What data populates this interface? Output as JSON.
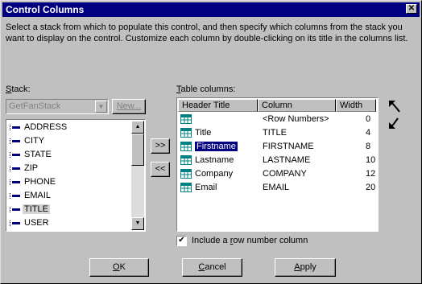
{
  "window": {
    "title": "Control Columns",
    "close_glyph": "✕"
  },
  "description": "Select a stack from which to populate this control, and then specify which columns from the stack you want to display on the control.  Customize each column by double-clicking on its title in the columns list.",
  "stack": {
    "label_prefix": "",
    "label_mnemonic": "S",
    "label_rest": "tack:",
    "selected_value": "GetFanStack",
    "new_button": "New...",
    "items": [
      "ADDRESS",
      "CITY",
      "STATE",
      "ZIP",
      "PHONE",
      "EMAIL",
      "TITLE",
      "USER"
    ],
    "selected_item": "TITLE"
  },
  "move_buttons": {
    "add": ">>",
    "remove": "<<"
  },
  "table_columns": {
    "label_mnemonic": "T",
    "label_rest": "able columns:",
    "headers": [
      "Header Title",
      "Column",
      "Width"
    ],
    "rows": [
      {
        "title": "",
        "column": "<Row Numbers>",
        "width": "0"
      },
      {
        "title": "Title",
        "column": "TITLE",
        "width": "4"
      },
      {
        "title": "Firstname",
        "column": "FIRSTNAME",
        "width": "8"
      },
      {
        "title": "Lastname",
        "column": "LASTNAME",
        "width": "10"
      },
      {
        "title": "Company",
        "column": "COMPANY",
        "width": "12"
      },
      {
        "title": "Email",
        "column": "EMAIL",
        "width": "20"
      }
    ],
    "selected_row": "Firstname"
  },
  "move_up_icon": "move-up-icon",
  "move_down_icon": "move-down-icon",
  "row_number_checkbox": {
    "checked": true,
    "label_prefix": "Include a ",
    "label_mnemonic": "r",
    "label_rest": "ow number column"
  },
  "buttons": {
    "ok": {
      "mnemonic": "O",
      "rest": "K"
    },
    "cancel": {
      "mnemonic": "C",
      "rest": "ancel"
    },
    "apply": {
      "mnemonic": "A",
      "rest": "pply"
    }
  }
}
